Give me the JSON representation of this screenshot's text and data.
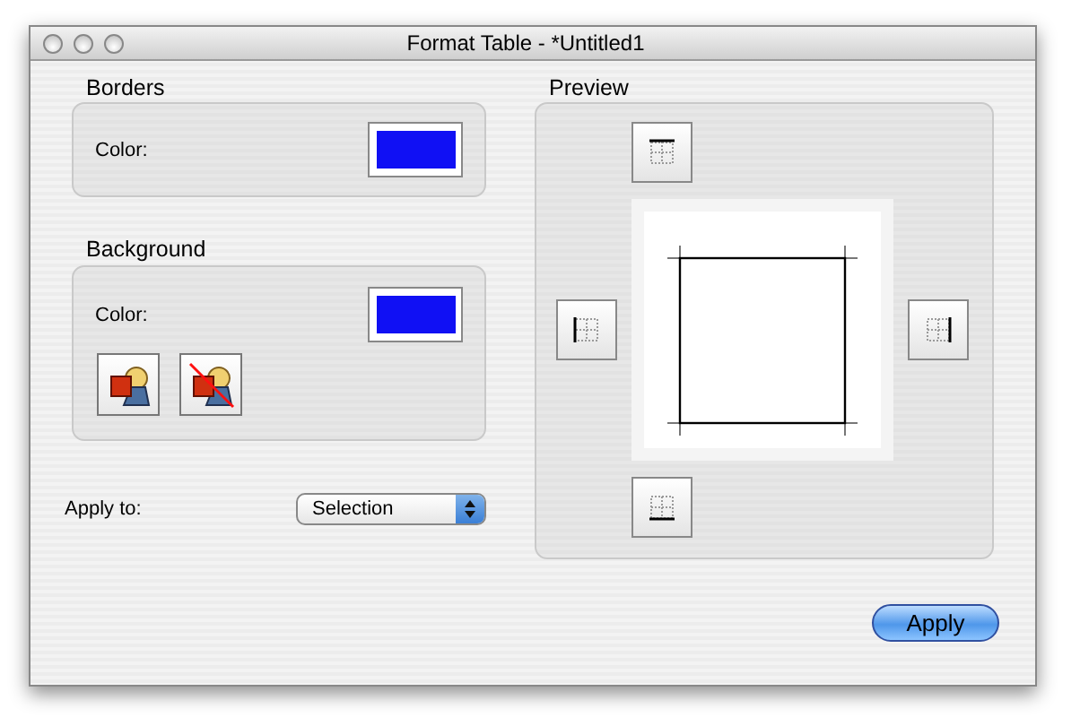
{
  "window": {
    "title": "Format Table - *Untitled1"
  },
  "borders": {
    "heading": "Borders",
    "color_label": "Color:",
    "color": "#1010f4"
  },
  "background": {
    "heading": "Background",
    "color_label": "Color:",
    "color": "#1010f4"
  },
  "apply_to": {
    "label": "Apply to:",
    "value": "Selection"
  },
  "preview": {
    "heading": "Preview"
  },
  "buttons": [
    "Apply"
  ]
}
